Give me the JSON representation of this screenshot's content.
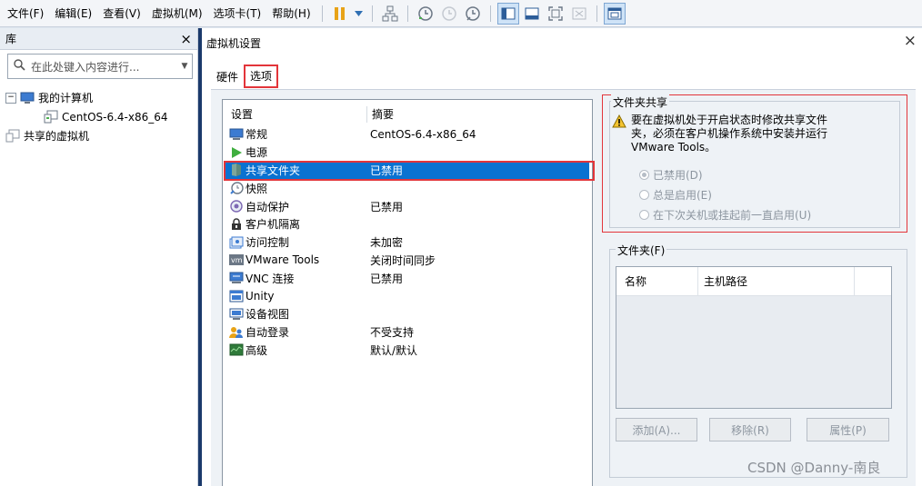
{
  "menu": [
    "文件(F)",
    "编辑(E)",
    "查看(V)",
    "虚拟机(M)",
    "选项卡(T)",
    "帮助(H)"
  ],
  "library": {
    "title": "库",
    "close": "×",
    "search_placeholder": "在此处键入内容进行...",
    "tree": [
      {
        "label": "我的计算机",
        "expander": "⊟"
      },
      {
        "label": "CentOS-6.4-x86_64"
      },
      {
        "label": "共享的虚拟机"
      }
    ]
  },
  "dialog": {
    "title": "虚拟机设置",
    "close": "×",
    "tabs": [
      "硬件",
      "选项"
    ],
    "selected_tab": "选项",
    "list_headers": [
      "设置",
      "摘要"
    ],
    "rows": [
      {
        "name": "常规",
        "summary": "CentOS-6.4-x86_64",
        "icon": "general-icon"
      },
      {
        "name": "电源",
        "summary": "",
        "icon": "power-icon"
      },
      {
        "name": "共享文件夹",
        "summary": "已禁用",
        "icon": "shared-folder-icon",
        "selected": true
      },
      {
        "name": "快照",
        "summary": "",
        "icon": "snapshot-icon"
      },
      {
        "name": "自动保护",
        "summary": "已禁用",
        "icon": "autoprotect-icon"
      },
      {
        "name": "客户机隔离",
        "summary": "",
        "icon": "lock-icon"
      },
      {
        "name": "访问控制",
        "summary": "未加密",
        "icon": "access-control-icon"
      },
      {
        "name": "VMware Tools",
        "summary": "关闭时间同步",
        "icon": "vmware-tools-icon"
      },
      {
        "name": "VNC 连接",
        "summary": "已禁用",
        "icon": "vnc-icon"
      },
      {
        "name": "Unity",
        "summary": "",
        "icon": "unity-icon"
      },
      {
        "name": "设备视图",
        "summary": "",
        "icon": "device-view-icon"
      },
      {
        "name": "自动登录",
        "summary": "不受支持",
        "icon": "autologin-icon"
      },
      {
        "name": "高级",
        "summary": "默认/默认",
        "icon": "advanced-icon"
      }
    ],
    "share": {
      "legend": "文件夹共享",
      "warning": "要在虚拟机处于开启状态时修改共享文件夹，必须在客户机操作系统中安装并运行 VMware Tools。",
      "options": [
        "已禁用(D)",
        "总是启用(E)",
        "在下次关机或挂起前一直启用(U)"
      ],
      "selected_option": "已禁用(D)"
    },
    "folders": {
      "legend": "文件夹(F)",
      "columns": [
        "名称",
        "主机路径"
      ],
      "buttons": [
        "添加(A)...",
        "移除(R)",
        "属性(P)"
      ]
    }
  },
  "watermark": "CSDN @Danny-南良",
  "colors": {
    "selection": "#0a72d1",
    "highlight_box": "#e3353a",
    "splitter": "#1b3a6b"
  }
}
